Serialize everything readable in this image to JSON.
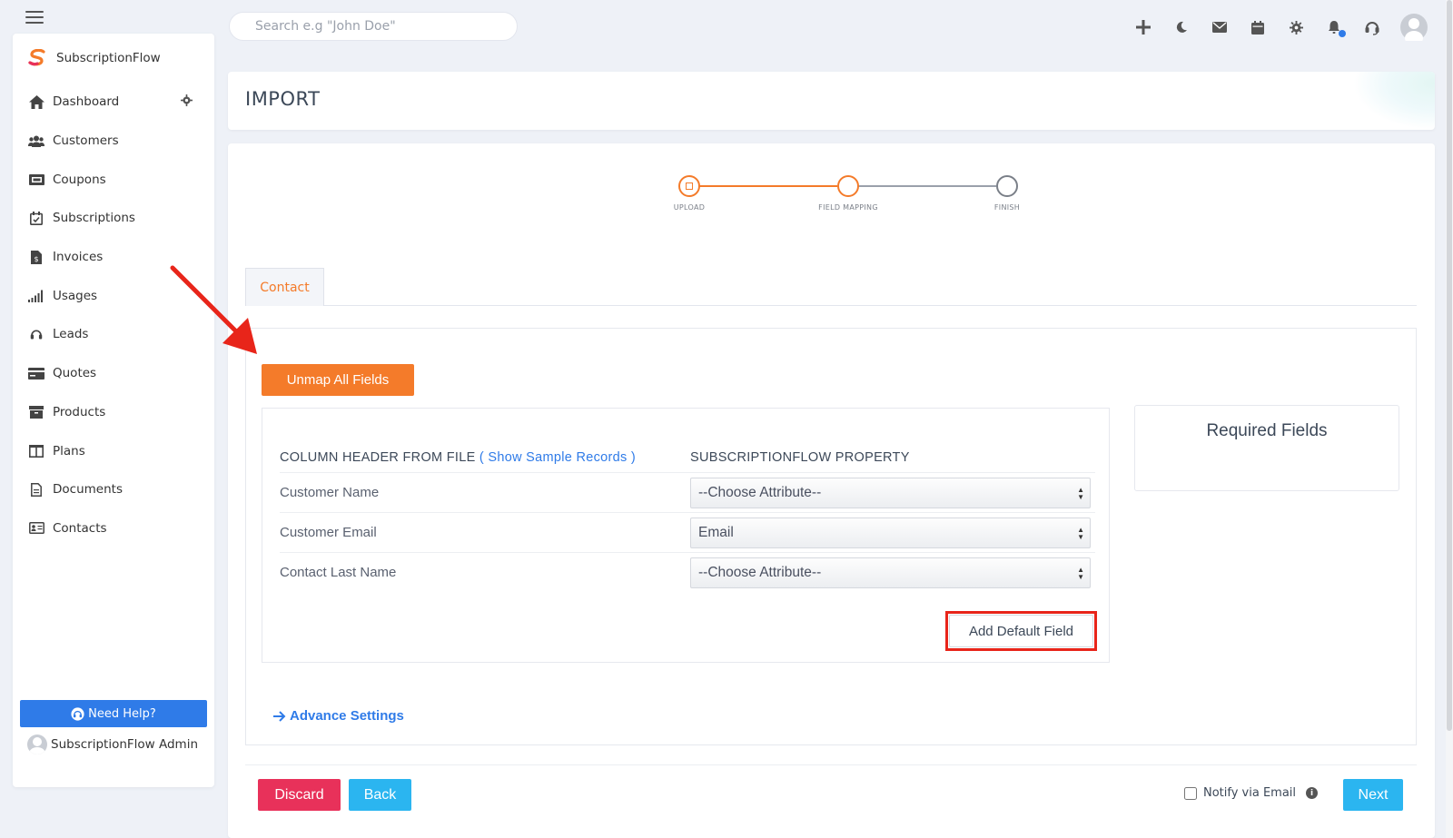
{
  "search": {
    "placeholder": "Search e.g \"John Doe\""
  },
  "brand": {
    "name": "SubscriptionFlow",
    "color": "#f47b2a"
  },
  "sidebar": {
    "items": [
      {
        "label": "Dashboard",
        "icon": "home-icon"
      },
      {
        "label": "Customers",
        "icon": "users-icon"
      },
      {
        "label": "Coupons",
        "icon": "ticket-icon"
      },
      {
        "label": "Subscriptions",
        "icon": "calendar-check-icon"
      },
      {
        "label": "Invoices",
        "icon": "invoice-icon"
      },
      {
        "label": "Usages",
        "icon": "signal-bars-icon"
      },
      {
        "label": "Leads",
        "icon": "headset-icon"
      },
      {
        "label": "Quotes",
        "icon": "card-icon"
      },
      {
        "label": "Products",
        "icon": "archive-icon"
      },
      {
        "label": "Plans",
        "icon": "columns-icon"
      },
      {
        "label": "Documents",
        "icon": "document-icon"
      },
      {
        "label": "Contacts",
        "icon": "contact-card-icon"
      }
    ],
    "help_label": "Need Help?",
    "admin_name": "SubscriptionFlow Admin"
  },
  "page": {
    "title": "IMPORT"
  },
  "stepper": {
    "steps": [
      "UPLOAD",
      "FIELD MAPPING",
      "FINISH"
    ],
    "accent": "#f47b2a"
  },
  "tabs": [
    {
      "label": "Contact",
      "active": true
    }
  ],
  "mapping": {
    "unmap_label": "Unmap All Fields",
    "column_header": "COLUMN HEADER FROM FILE",
    "sample_link": "( Show Sample Records )",
    "property_header": "SUBSCRIPTIONFLOW PROPERTY",
    "rows": [
      {
        "column": "Customer Name",
        "value": "--Choose Attribute--"
      },
      {
        "column": "Customer Email",
        "value": "Email"
      },
      {
        "column": "Contact Last Name",
        "value": "--Choose Attribute--"
      }
    ],
    "add_default_label": "Add Default Field",
    "required_title": "Required Fields",
    "advance_label": "Advance Settings"
  },
  "footer": {
    "discard_label": "Discard",
    "back_label": "Back",
    "notify_label": "Notify via Email",
    "next_label": "Next"
  },
  "colors": {
    "primary_blue": "#2f7be8",
    "discard_red": "#e8315a",
    "light_blue": "#2bb5f0",
    "highlight_red": "#e8251a"
  }
}
